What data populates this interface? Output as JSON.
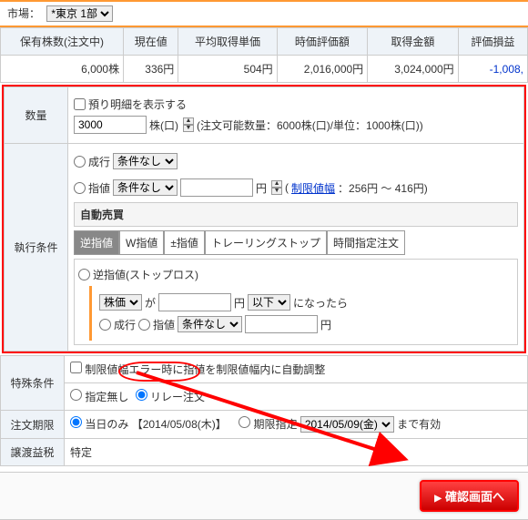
{
  "market": {
    "label": "市場：",
    "selected": "*東京 1部"
  },
  "table": {
    "headers": [
      "保有株数(注文中)",
      "現在値",
      "平均取得単価",
      "時価評価額",
      "取得金額",
      "評価損益"
    ],
    "row": [
      "6,000株",
      "336円",
      "504円",
      "2,016,000円",
      "3,024,000円",
      "-1,008,"
    ]
  },
  "qty": {
    "label": "数量",
    "checkbox": "預り明細を表示する",
    "value": "3000",
    "unit": "株(口)",
    "note": "(注文可能数量：6000株(口)/単位：1000株(口))"
  },
  "exec": {
    "label": "執行条件",
    "market_order": "成行",
    "cond_none": "条件なし",
    "limit_order": "指値",
    "yen": "円",
    "limit_link": "制限値幅",
    "limit_range": "：256円 ～ 416円)",
    "auto_title": "自動売買",
    "tabs": [
      "逆指値",
      "W指値",
      "±指値",
      "トレーリングストップ",
      "時間指定注文"
    ],
    "stoploss_label": "逆指値(ストップロス)",
    "price_type": "株価",
    "ga": "が",
    "cond": "以下",
    "ninattara": "になったら"
  },
  "special": {
    "auto_adjust": "制限値幅エラー時に指値を制限値幅内に自動調整",
    "label": "特殊条件",
    "opt1": "指定無し",
    "opt2": "リレー注文"
  },
  "period": {
    "label": "注文期限",
    "opt1": "当日のみ",
    "date1": "【2014/05/08(木)】",
    "opt2": "期限指定",
    "date2": "2014/05/09(金)",
    "suffix": "まで有効"
  },
  "tax": {
    "label": "譲渡益税",
    "value": "特定"
  },
  "confirm": "確認画面へ"
}
